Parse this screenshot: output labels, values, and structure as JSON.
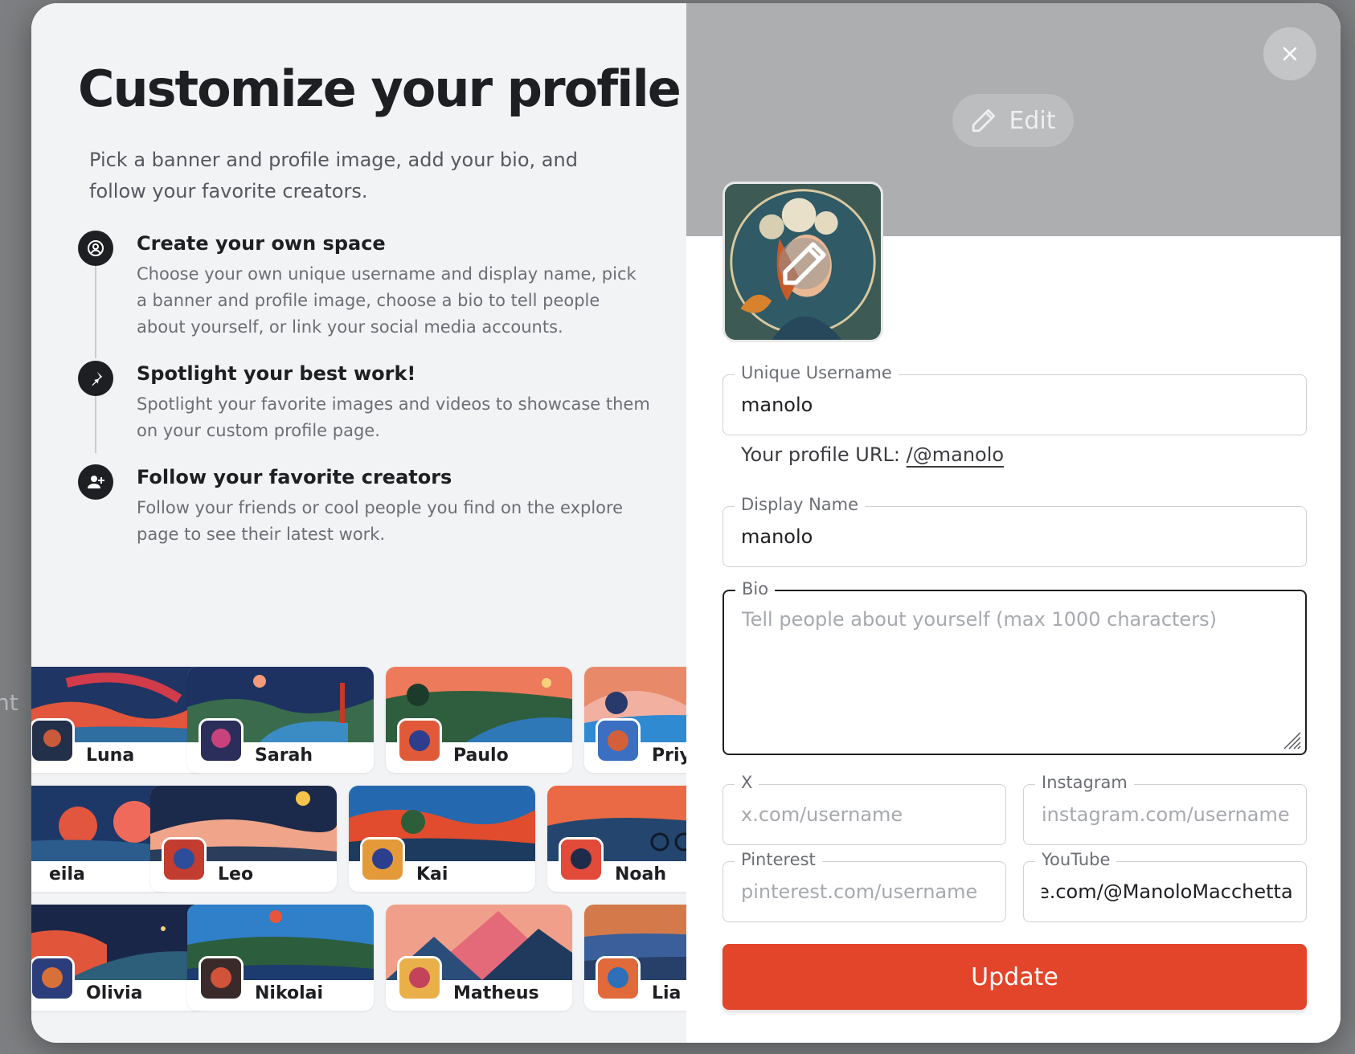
{
  "backdrop": {
    "partial_text": "ht"
  },
  "left": {
    "title": "Customize your profile!",
    "subtitle": "Pick a banner and profile image, add your bio, and follow your favorite creators.",
    "features": [
      {
        "icon": "user-circle-icon",
        "title": "Create your own space",
        "description": "Choose your own unique username and display name, pick a banner and profile image, choose a bio to tell people about yourself, or link your social media accounts."
      },
      {
        "icon": "pin-icon",
        "title": "Spotlight your best work!",
        "description": "Spotlight your favorite images and videos to showcase them on your custom profile page."
      },
      {
        "icon": "user-plus-icon",
        "title": "Follow your favorite creators",
        "description": "Follow your friends or cool people you find on the explore page to see their latest work."
      }
    ],
    "creators": [
      [
        "Luna",
        "Sarah",
        "Paulo",
        "Priya"
      ],
      [
        "eila",
        "Leo",
        "Kai",
        "Noah"
      ],
      [
        "Olivia",
        "Nikolai",
        "Matheus",
        "Lia"
      ]
    ]
  },
  "right": {
    "edit_label": "Edit",
    "close_icon": "close-icon",
    "username": {
      "label": "Unique Username",
      "value": "manolo"
    },
    "profile_url": {
      "prefix": "Your profile URL:",
      "link": "/@manolo"
    },
    "display_name": {
      "label": "Display Name",
      "value": "manolo"
    },
    "bio": {
      "label": "Bio",
      "placeholder": "Tell people about yourself (max 1000 characters)",
      "value": ""
    },
    "x": {
      "label": "X",
      "placeholder": "x.com/username",
      "value": ""
    },
    "instagram": {
      "label": "Instagram",
      "placeholder": "instagram.com/username",
      "value": ""
    },
    "pinterest": {
      "label": "Pinterest",
      "placeholder": "pinterest.com/username",
      "value": ""
    },
    "youtube": {
      "label": "YouTube",
      "placeholder": "",
      "value": "youtube.com/@ManoloMacchetta"
    },
    "update_label": "Update"
  },
  "colors": {
    "accent": "#e2452a",
    "dark": "#1e1f22",
    "banner_gray": "#adaeaf"
  }
}
